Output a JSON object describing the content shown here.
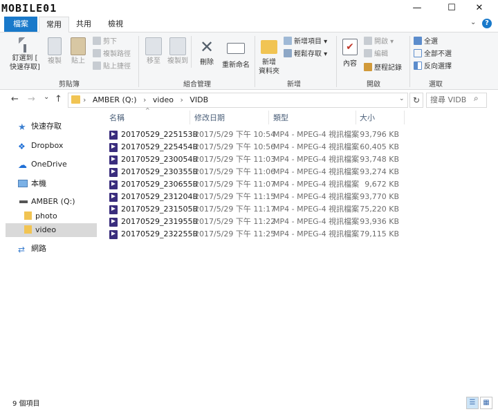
{
  "watermark": "MOBILE01",
  "window": {
    "minimize": "—",
    "maximize": "☐",
    "close": "✕"
  },
  "tabs": {
    "file": "檔案",
    "home": "常用",
    "share": "共用",
    "view": "檢視"
  },
  "ribbon": {
    "clipboard": {
      "pin_line1": "釘選到 [",
      "pin_line2": "快速存取]",
      "copy": "複製",
      "paste": "貼上",
      "cut": "剪下",
      "copy_path": "複製路徑",
      "paste_shortcut": "貼上捷徑",
      "label": "剪貼簿"
    },
    "organize": {
      "move_to": "移至",
      "copy_to": "複製到",
      "delete": "刪除",
      "rename": "重新命名",
      "label": "組合管理"
    },
    "new": {
      "new_folder_line1": "新增",
      "new_folder_line2": "資料夾",
      "new_item": "新增項目",
      "easy_access": "輕鬆存取",
      "label": "新增"
    },
    "open": {
      "properties": "內容",
      "open": "開啟",
      "edit": "編輯",
      "history": "歷程記錄",
      "label": "開啟"
    },
    "select": {
      "select_all": "全選",
      "select_none": "全部不選",
      "invert": "反向選擇",
      "label": "選取"
    }
  },
  "nav": {
    "back": "←",
    "forward": "→",
    "recent": "⌄",
    "up": "↑"
  },
  "address": {
    "path": [
      "AMBER (Q:)",
      "video",
      "VIDB"
    ],
    "sep": "›",
    "root_sep": "›"
  },
  "search": {
    "placeholder": "搜尋 VIDB",
    "icon": "⌕"
  },
  "sidebar": {
    "items": [
      {
        "label": "快速存取"
      },
      {
        "label": "Dropbox"
      },
      {
        "label": "OneDrive"
      },
      {
        "label": "本機"
      },
      {
        "label": "AMBER (Q:)"
      },
      {
        "label": "photo"
      },
      {
        "label": "video"
      },
      {
        "label": "網路"
      }
    ]
  },
  "columns": {
    "name": "名稱",
    "date": "修改日期",
    "type": "類型",
    "size": "大小"
  },
  "files": [
    {
      "name": "20170529_225153B",
      "date": "2017/5/29 下午 10:54",
      "type": "MP4 - MPEG-4 視訊檔案",
      "size": "93,796 KB"
    },
    {
      "name": "20170529_225454B",
      "date": "2017/5/29 下午 10:56",
      "type": "MP4 - MPEG-4 視訊檔案",
      "size": "60,405 KB"
    },
    {
      "name": "20170529_230054B",
      "date": "2017/5/29 下午 11:03",
      "type": "MP4 - MPEG-4 視訊檔案",
      "size": "93,748 KB"
    },
    {
      "name": "20170529_230355B",
      "date": "2017/5/29 下午 11:06",
      "type": "MP4 - MPEG-4 視訊檔案",
      "size": "93,274 KB"
    },
    {
      "name": "20170529_230655B",
      "date": "2017/5/29 下午 11:07",
      "type": "MP4 - MPEG-4 視訊檔案",
      "size": "9,672 KB"
    },
    {
      "name": "20170529_231204B",
      "date": "2017/5/29 下午 11:15",
      "type": "MP4 - MPEG-4 視訊檔案",
      "size": "93,770 KB"
    },
    {
      "name": "20170529_231505B",
      "date": "2017/5/29 下午 11:17",
      "type": "MP4 - MPEG-4 視訊檔案",
      "size": "75,220 KB"
    },
    {
      "name": "20170529_231955B",
      "date": "2017/5/29 下午 11:22",
      "type": "MP4 - MPEG-4 視訊檔案",
      "size": "93,936 KB"
    },
    {
      "name": "20170529_232255B",
      "date": "2017/5/29 下午 11:25",
      "type": "MP4 - MPEG-4 視訊檔案",
      "size": "79,115 KB"
    }
  ],
  "status": {
    "count": "9 個項目"
  },
  "colors": {
    "accent": "#1979ca",
    "folder": "#f1c453",
    "selection": "#d9d9d9"
  }
}
